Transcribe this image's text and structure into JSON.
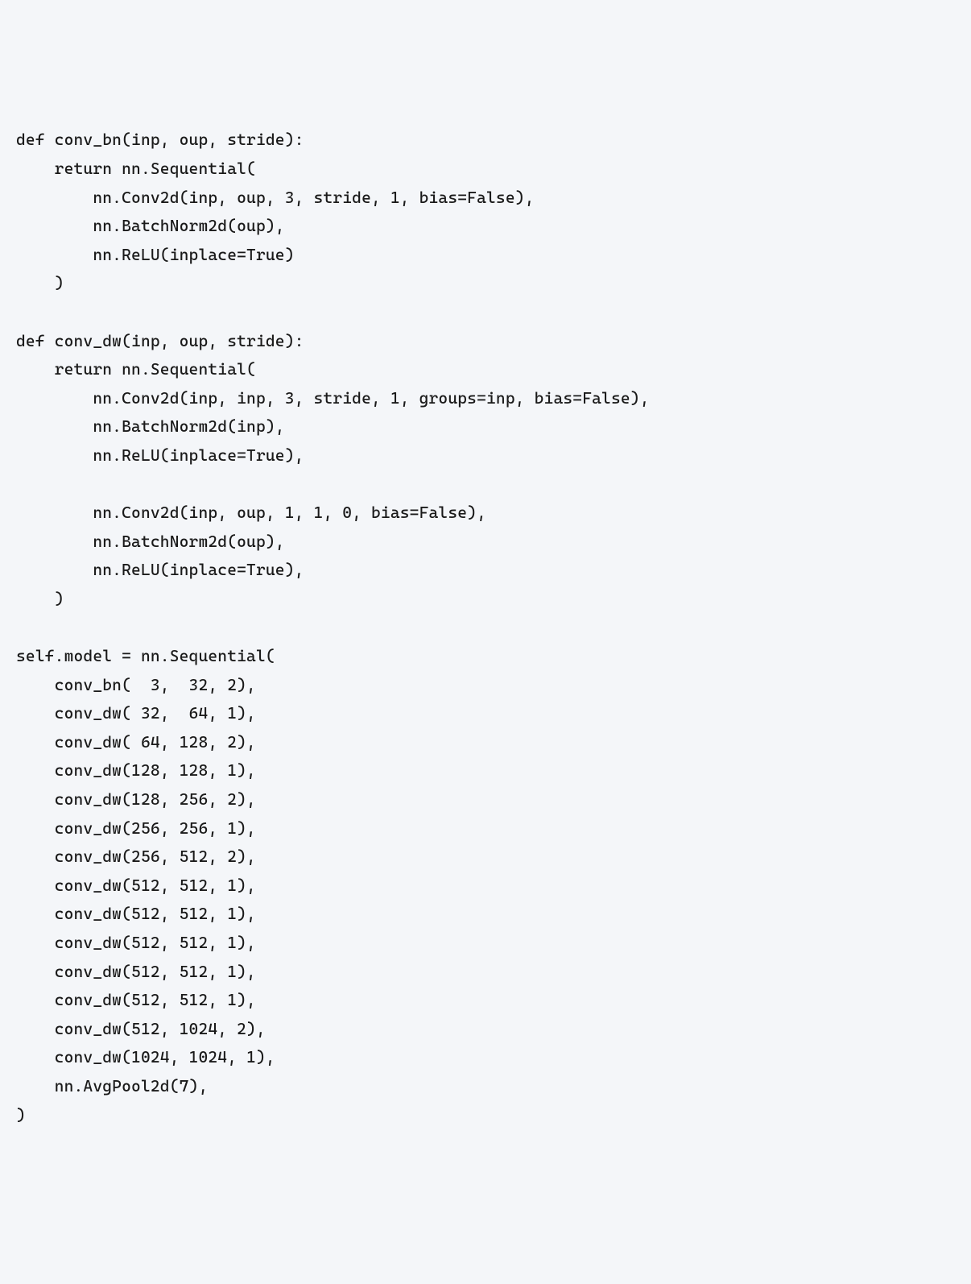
{
  "code": {
    "lines": [
      "def conv_bn(inp, oup, stride):",
      "    return nn.Sequential(",
      "        nn.Conv2d(inp, oup, 3, stride, 1, bias=False),",
      "        nn.BatchNorm2d(oup),",
      "        nn.ReLU(inplace=True)",
      "    )",
      "",
      "def conv_dw(inp, oup, stride):",
      "    return nn.Sequential(",
      "        nn.Conv2d(inp, inp, 3, stride, 1, groups=inp, bias=False),",
      "        nn.BatchNorm2d(inp),",
      "        nn.ReLU(inplace=True),",
      "",
      "        nn.Conv2d(inp, oup, 1, 1, 0, bias=False),",
      "        nn.BatchNorm2d(oup),",
      "        nn.ReLU(inplace=True),",
      "    )",
      "",
      "self.model = nn.Sequential(",
      "    conv_bn(  3,  32, 2),",
      "    conv_dw( 32,  64, 1),",
      "    conv_dw( 64, 128, 2),",
      "    conv_dw(128, 128, 1),",
      "    conv_dw(128, 256, 2),",
      "    conv_dw(256, 256, 1),",
      "    conv_dw(256, 512, 2),",
      "    conv_dw(512, 512, 1),",
      "    conv_dw(512, 512, 1),",
      "    conv_dw(512, 512, 1),",
      "    conv_dw(512, 512, 1),",
      "    conv_dw(512, 512, 1),",
      "    conv_dw(512, 1024, 2),",
      "    conv_dw(1024, 1024, 1),",
      "    nn.AvgPool2d(7),",
      ")"
    ]
  }
}
